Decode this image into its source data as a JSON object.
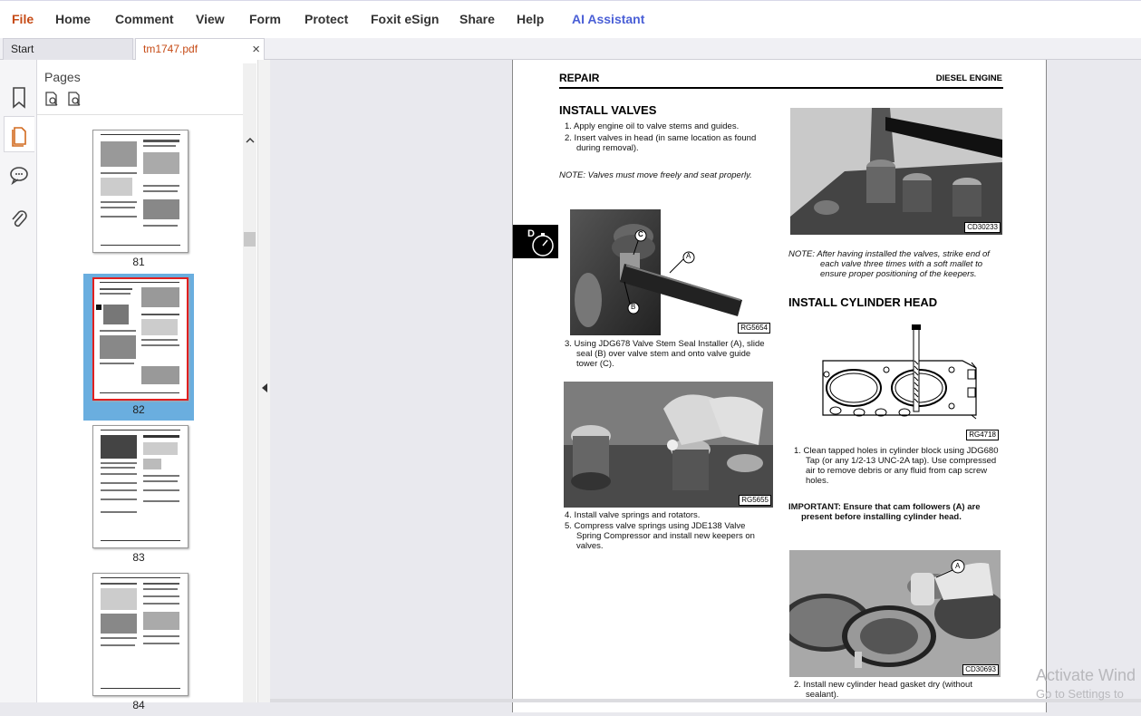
{
  "menu": {
    "file": "File",
    "home": "Home",
    "comment": "Comment",
    "view": "View",
    "form": "Form",
    "protect": "Protect",
    "esign": "Foxit eSign",
    "share": "Share",
    "help": "Help",
    "ai": "AI Assistant"
  },
  "tabs": {
    "start": "Start",
    "doc": "tm1747.pdf",
    "close": "×"
  },
  "pages_panel": {
    "title": "Pages",
    "thumbs": [
      {
        "label": "81"
      },
      {
        "label": "82"
      },
      {
        "label": "83"
      },
      {
        "label": "84"
      }
    ]
  },
  "document": {
    "header_left": "REPAIR",
    "header_right": "DIESEL ENGINE",
    "side_tab": "D",
    "install_valves": {
      "title": "INSTALL VALVES",
      "step1": "1. Apply engine oil to valve stems and guides.",
      "step2a": "2. Insert valves in head (in same location as found",
      "step2b": "during removal).",
      "note": "NOTE:  Valves must move freely and seat properly.",
      "step3a": "3. Using JDG678 Valve Stem Seal Installer (A), slide",
      "step3b": "seal (B) over valve stem and onto valve guide",
      "step3c": "tower (C).",
      "step4": "4. Install valve springs and rotators.",
      "step5a": "5. Compress valve springs using JDE138 Valve",
      "step5b": "Spring Compressor and install new keepers on",
      "step5c": "valves."
    },
    "note2": {
      "l1": "NOTE:  After having installed the valves, strike end of",
      "l2": "each valve three times with a soft mallet to",
      "l3": "ensure proper positioning of the keepers."
    },
    "cyl_head": {
      "title": "INSTALL CYLINDER HEAD",
      "step1a": "1. Clean tapped holes in cylinder block using JDG680",
      "step1b": "Tap (or any 1/2-13 UNC-2A tap). Use compressed",
      "step1c": "air to remove debris or any fluid from cap screw",
      "step1d": "holes.",
      "important_a": "IMPORTANT:   Ensure that cam followers (A) are",
      "important_b": "present before installing cylinder head.",
      "step2a": "2. Install new cylinder head gasket dry (without",
      "step2b": "sealant)."
    },
    "codes": {
      "cd30233": "CD30233",
      "rg5654": "RG5654",
      "rg5655": "RG5655",
      "rg4718": "RG4718",
      "cd30693": "CD30693"
    },
    "callouts": {
      "a": "A",
      "b": "B",
      "c": "C"
    }
  },
  "watermark": {
    "l1": "Activate Wind",
    "l2": "Go to Settings to"
  },
  "colors": {
    "accent_orange": "#c64b16",
    "ai_blue": "#4a5fd6",
    "selection": "#6aaedf",
    "sel_border": "#e02020"
  }
}
